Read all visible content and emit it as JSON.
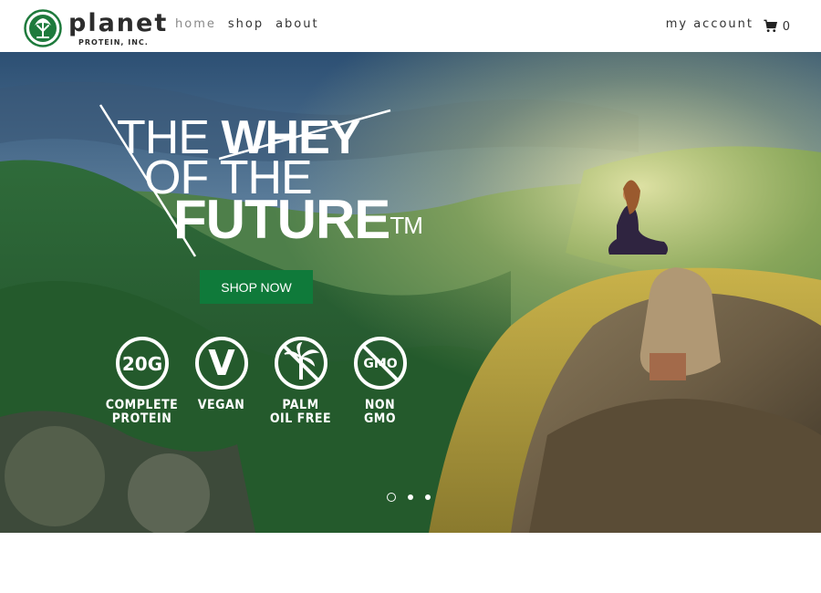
{
  "brand": {
    "name": "planet",
    "subtitle": "PROTEIN, INC.",
    "color": "#1e7a3c"
  },
  "nav": {
    "items": [
      {
        "label": "home",
        "active": true
      },
      {
        "label": "shop",
        "active": false
      },
      {
        "label": "about",
        "active": false
      }
    ]
  },
  "account": {
    "label": "my account",
    "cart_count": "0",
    "cart_icon": "shopping-cart-icon"
  },
  "hero": {
    "headline": {
      "line1_plain": "THE ",
      "line1_strike": "WHEY",
      "line2": "OF THE",
      "line3": "FUTURE",
      "trademark": "TM"
    },
    "cta_label": "SHOP NOW",
    "cta_color": "#0f7a3a",
    "badges": [
      {
        "icon": "20g-icon",
        "symbol": "20G",
        "label": "COMPLETE\nPROTEIN"
      },
      {
        "icon": "vegan-v-icon",
        "symbol": "V",
        "label": "VEGAN"
      },
      {
        "icon": "palm-tree-crossed-icon",
        "symbol": "",
        "label": "PALM\nOIL FREE"
      },
      {
        "icon": "gmo-crossed-icon",
        "symbol": "GMO",
        "label": "NON\nGMO"
      }
    ],
    "slides": {
      "count": 3,
      "active": 0
    }
  }
}
